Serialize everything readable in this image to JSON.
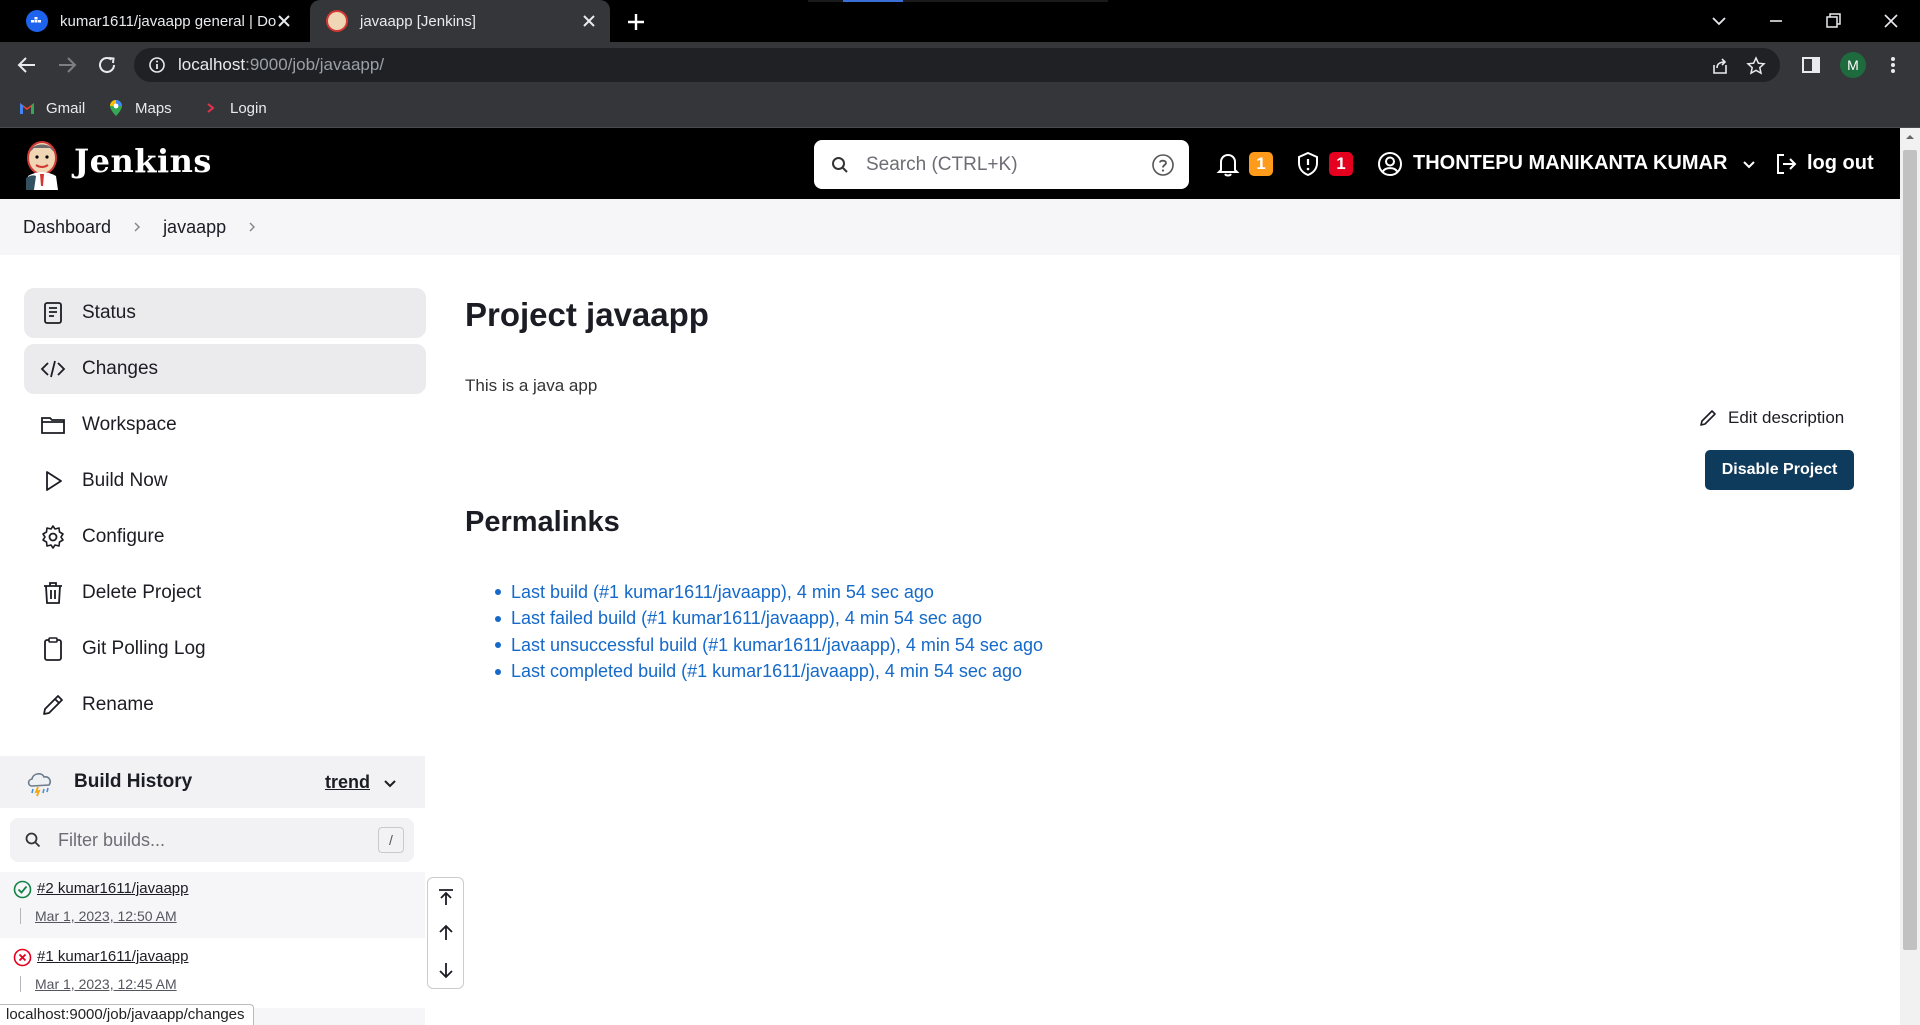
{
  "browser": {
    "tabs": [
      {
        "title": "kumar1611/javaapp general | Do",
        "favicon": "docker-icon",
        "active": false
      },
      {
        "title": "javaapp [Jenkins]",
        "favicon": "jenkins-icon",
        "active": true
      }
    ],
    "address": {
      "host": "localhost",
      "path": ":9000/job/javaapp/"
    },
    "profile_initial": "M",
    "bookmarks": [
      {
        "label": "Gmail",
        "icon": "gmail-icon"
      },
      {
        "label": "Maps",
        "icon": "maps-icon"
      },
      {
        "label": "Login",
        "icon": "login-icon"
      }
    ],
    "status_url": "localhost:9000/job/javaapp/changes"
  },
  "header": {
    "brand": "Jenkins",
    "search_placeholder": "Search (CTRL+K)",
    "notifications_count": "1",
    "security_count": "1",
    "user_name": "THONTEPU MANIKANTA KUMAR",
    "logout_label": "log out",
    "colors": {
      "notification_badge": "#fe9b1b",
      "security_badge": "#e6001f",
      "header_bg": "#000000"
    }
  },
  "breadcrumbs": [
    "Dashboard",
    "javaapp"
  ],
  "sidebar": {
    "tasks": [
      {
        "label": "Status",
        "icon": "status-icon"
      },
      {
        "label": "Changes",
        "icon": "code-icon"
      },
      {
        "label": "Workspace",
        "icon": "folder-icon"
      },
      {
        "label": "Build Now",
        "icon": "play-icon"
      },
      {
        "label": "Configure",
        "icon": "gear-icon"
      },
      {
        "label": "Delete Project",
        "icon": "trash-icon"
      },
      {
        "label": "Git Polling Log",
        "icon": "clipboard-icon"
      },
      {
        "label": "Rename",
        "icon": "pencil-icon"
      }
    ],
    "build_history": {
      "title": "Build History",
      "trend_label": "trend",
      "filter_placeholder": "Filter builds...",
      "filter_shortcut": "/",
      "builds": [
        {
          "name": "#2 kumar1611/javaapp",
          "date": "Mar 1, 2023, 12:50 AM",
          "status": "success"
        },
        {
          "name": "#1 kumar1611/javaapp",
          "date": "Mar 1, 2023, 12:45 AM",
          "status": "failed"
        }
      ]
    }
  },
  "main": {
    "title": "Project javaapp",
    "description": "This is a java app",
    "edit_description_label": "Edit description",
    "disable_button_label": "Disable Project",
    "permalinks_title": "Permalinks",
    "permalinks": [
      "Last build (#1 kumar1611/javaapp), 4 min 54 sec ago",
      "Last failed build (#1 kumar1611/javaapp), 4 min 54 sec ago",
      "Last unsuccessful build (#1 kumar1611/javaapp), 4 min 54 sec ago",
      "Last completed build (#1 kumar1611/javaapp), 4 min 54 sec ago"
    ]
  }
}
